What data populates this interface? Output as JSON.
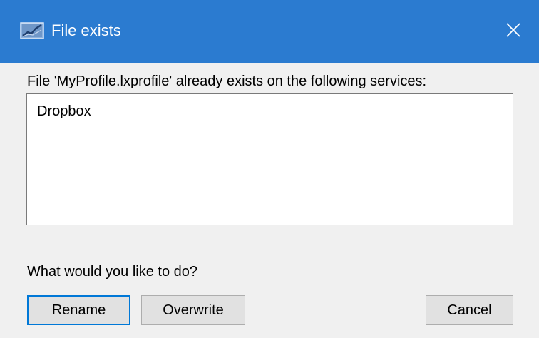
{
  "window": {
    "title": "File exists",
    "icon": "app-chart-icon",
    "close_icon": "close-icon"
  },
  "message": "File 'MyProfile.lxprofile' already exists on the following services:",
  "services": [
    "Dropbox"
  ],
  "question": "What would you like to do?",
  "buttons": {
    "rename": "Rename",
    "overwrite": "Overwrite",
    "cancel": "Cancel"
  },
  "colors": {
    "titlebar": "#2b7bd0",
    "background": "#f0f0f0",
    "default_button_border": "#0078d7"
  }
}
